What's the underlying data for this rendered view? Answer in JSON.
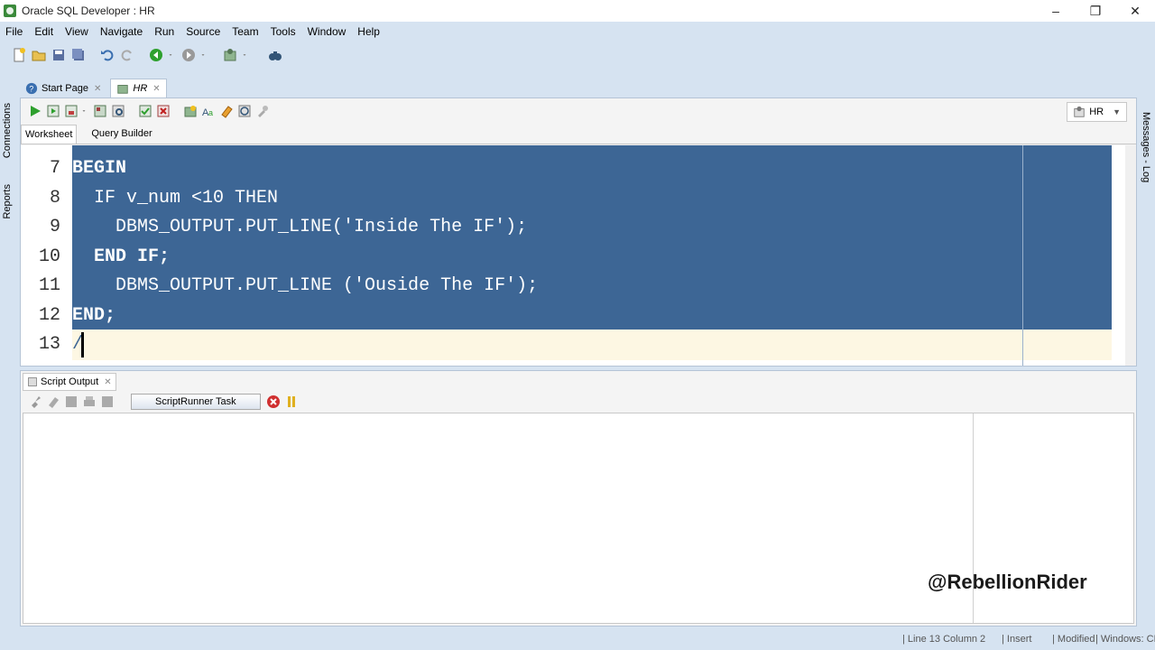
{
  "window": {
    "title": "Oracle SQL Developer : HR",
    "minimize": "–",
    "maximize": "❐",
    "close": "✕"
  },
  "menu": [
    "File",
    "Edit",
    "View",
    "Navigate",
    "Run",
    "Source",
    "Team",
    "Tools",
    "Window",
    "Help"
  ],
  "side_tabs": {
    "connections": "Connections",
    "reports": "Reports",
    "messages": "Messages - Log"
  },
  "doc_tabs": [
    {
      "label": "Start Page"
    },
    {
      "label": "HR"
    }
  ],
  "editor": {
    "connection": "HR",
    "subtabs": [
      "Worksheet",
      "Query Builder"
    ],
    "lines": [
      {
        "num": "7",
        "text": "BEGIN"
      },
      {
        "num": "8",
        "text": "  IF v_num <10 THEN"
      },
      {
        "num": "9",
        "text": "    DBMS_OUTPUT.PUT_LINE('Inside The IF');"
      },
      {
        "num": "10",
        "text": "  END IF;"
      },
      {
        "num": "11",
        "text": "    DBMS_OUTPUT.PUT_LINE ('Ouside The IF');"
      },
      {
        "num": "12",
        "text": "END;"
      },
      {
        "num": "13",
        "text": "/"
      }
    ]
  },
  "output": {
    "tab_label": "Script Output",
    "task_label": "ScriptRunner Task"
  },
  "watermark": "@RebellionRider",
  "status": {
    "position": "Line 13 Column 2",
    "mode": "Insert",
    "modified": "Modified",
    "eol": "Windows: CR"
  }
}
